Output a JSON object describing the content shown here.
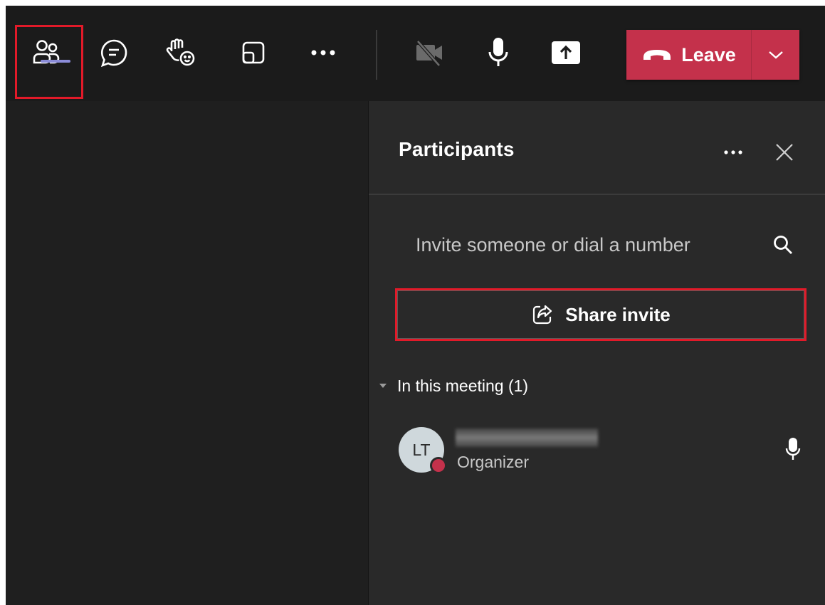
{
  "toolbar": {
    "buttons": [
      {
        "name": "people",
        "icon": "people-icon"
      },
      {
        "name": "chat",
        "icon": "chat-icon"
      },
      {
        "name": "react",
        "icon": "raise-hand-icon"
      },
      {
        "name": "rooms",
        "icon": "breakout-rooms-icon"
      },
      {
        "name": "more",
        "icon": "more-icon"
      },
      {
        "name": "camera",
        "icon": "camera-off-icon"
      },
      {
        "name": "mic",
        "icon": "mic-icon"
      },
      {
        "name": "share",
        "icon": "share-tray-icon"
      }
    ],
    "leave_label": "Leave",
    "leave_icon": "phone-hangup-icon",
    "leave_caret_icon": "chevron-down-icon"
  },
  "panel": {
    "title": "Participants",
    "invite_placeholder": "Invite someone or dial a number",
    "share_invite_label": "Share invite",
    "section_label": "In this meeting (1)",
    "participants": [
      {
        "initials": "LT",
        "role": "Organizer",
        "status": "busy"
      }
    ]
  },
  "colors": {
    "accent": "#8b8cd8",
    "leave": "#c4314b",
    "highlight": "#e21a29",
    "panel_bg": "#292929",
    "toolbar_bg": "#1b1b1b"
  }
}
